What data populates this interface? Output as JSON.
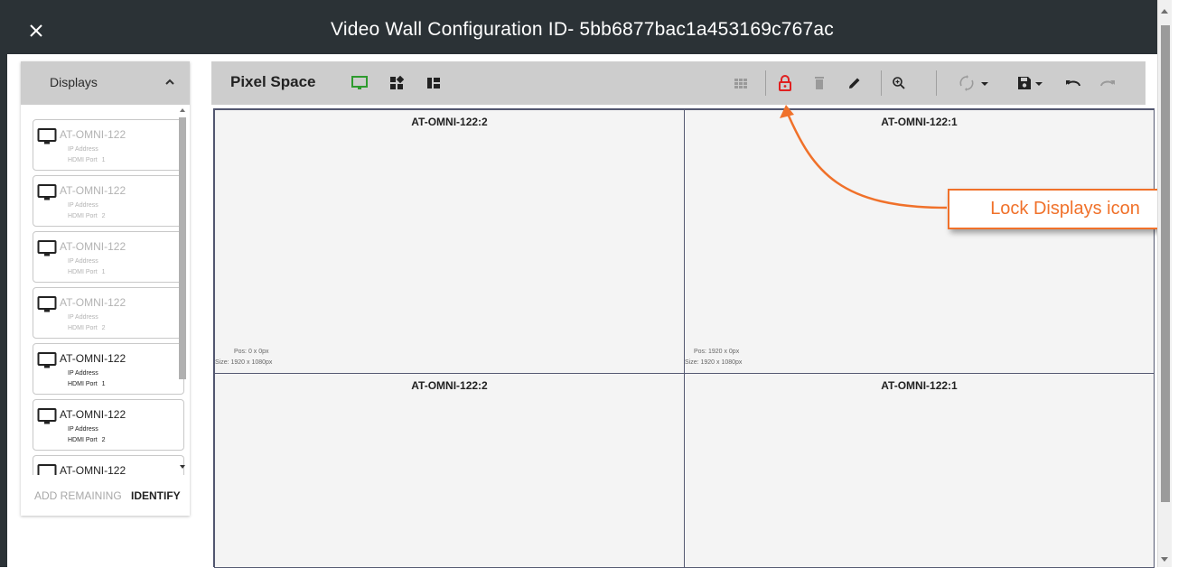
{
  "window": {
    "title": "Video Wall Configuration ID- 5bb6877bac1a453169c767ac"
  },
  "sidebar": {
    "header": "Displays",
    "items": [
      {
        "name": "AT-OMNI-122",
        "ip_label": "IP Address",
        "port_label": "HDMI Port",
        "port": "1",
        "active": false
      },
      {
        "name": "AT-OMNI-122",
        "ip_label": "IP Address",
        "port_label": "HDMI Port",
        "port": "2",
        "active": false
      },
      {
        "name": "AT-OMNI-122",
        "ip_label": "IP Address",
        "port_label": "HDMI Port",
        "port": "1",
        "active": false
      },
      {
        "name": "AT-OMNI-122",
        "ip_label": "IP Address",
        "port_label": "HDMI Port",
        "port": "2",
        "active": false
      },
      {
        "name": "AT-OMNI-122",
        "ip_label": "IP Address",
        "port_label": "HDMI Port",
        "port": "1",
        "active": true
      },
      {
        "name": "AT-OMNI-122",
        "ip_label": "IP Address",
        "port_label": "HDMI Port",
        "port": "2",
        "active": true
      },
      {
        "name": "AT-OMNI-122",
        "ip_label": "",
        "port_label": "",
        "port": "",
        "active": true
      }
    ],
    "add_remaining": "ADD REMAINING",
    "identify": "IDENTIFY"
  },
  "toolbar": {
    "title": "Pixel Space",
    "icons": [
      "monitor-icon",
      "layout-blocks-icon",
      "layout-list-icon",
      "grid-icon",
      "lock-open-icon",
      "trash-icon",
      "pencil-icon",
      "zoom-icon",
      "refresh-icon",
      "save-icon",
      "undo-icon",
      "redo-icon"
    ],
    "accent_green": "#2e9b2e",
    "accent_red": "#e02020"
  },
  "canvas": {
    "tiles": [
      {
        "name": "AT-OMNI-122:2",
        "pos": "Pos: 0 x 0px",
        "size": "Size: 1920 x 1080px"
      },
      {
        "name": "AT-OMNI-122:1",
        "pos": "Pos: 1920 x 0px",
        "size": "Size: 1920 x 1080px"
      },
      {
        "name": "AT-OMNI-122:2",
        "pos": "",
        "size": ""
      },
      {
        "name": "AT-OMNI-122:1",
        "pos": "",
        "size": ""
      }
    ]
  },
  "callout": {
    "text": "Lock Displays icon",
    "color": "#f0712a"
  }
}
